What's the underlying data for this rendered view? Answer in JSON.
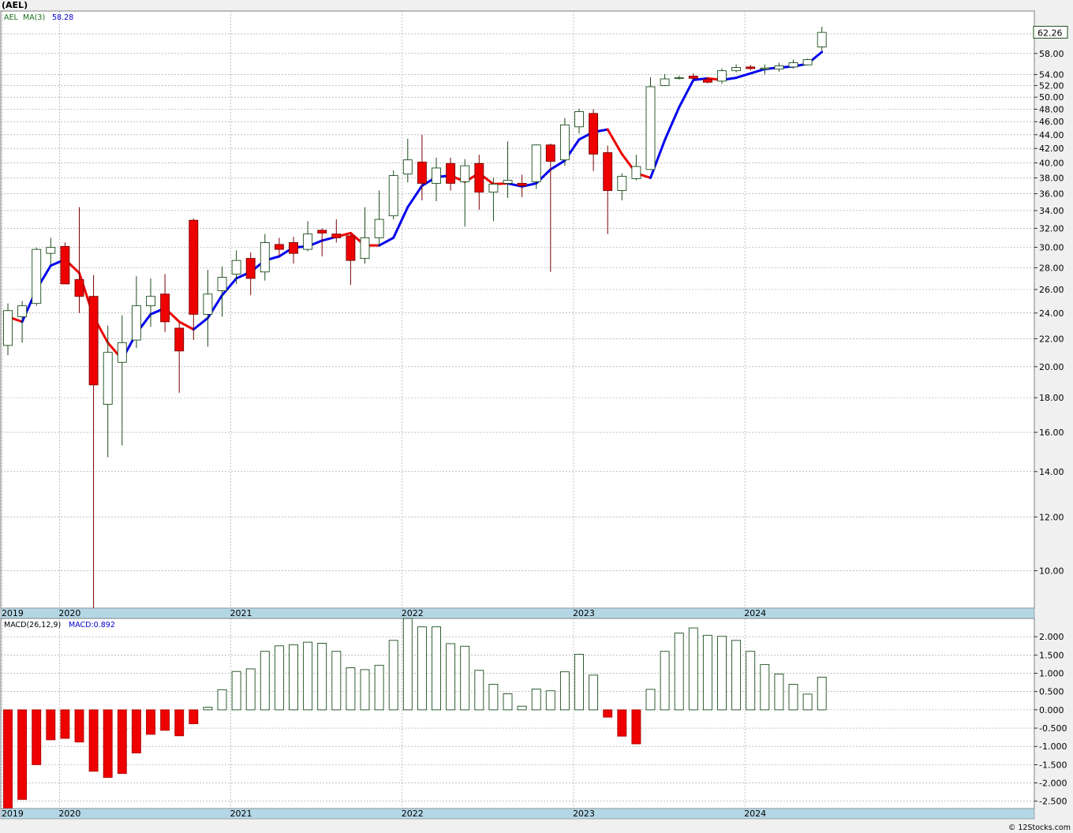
{
  "header": {
    "title": "(AEL)"
  },
  "legend": {
    "ticker": "AEL",
    "ma_label": "MA(3)",
    "ma_value": "58.28",
    "ma_color": "#00008b",
    "ma_up_color": "#0000ee",
    "ma_down_color": "#ee0000"
  },
  "macd_legend": {
    "label": "MACD(26,12,9)",
    "value_label": "MACD:0.892"
  },
  "last_price": "62.26",
  "footer": {
    "credit": "© 12Stocks.com"
  },
  "colors": {
    "up_outline": "#1a4d1a",
    "down_fill": "#ee0000",
    "axis_band": "#b4d7e6"
  },
  "chart_data": [
    {
      "type": "candlestick",
      "title": "(AEL)",
      "scale": "log",
      "ylim": [
        8.8,
        67
      ],
      "y_ticks": [
        10,
        12,
        14,
        16,
        18,
        20,
        22,
        24,
        26,
        28,
        30,
        32,
        34,
        36,
        38,
        40,
        42,
        44,
        46,
        48,
        50,
        52,
        54,
        58,
        62
      ],
      "x_ticks": [
        {
          "label": "2019",
          "index": 0
        },
        {
          "label": "2020",
          "index": 4
        },
        {
          "label": "2021",
          "index": 16
        },
        {
          "label": "2022",
          "index": 28
        },
        {
          "label": "2023",
          "index": 40
        },
        {
          "label": "2024",
          "index": 52
        }
      ],
      "candles": [
        {
          "o": 21.5,
          "h": 24.8,
          "l": 20.8,
          "c": 24.2
        },
        {
          "o": 23.7,
          "h": 25.0,
          "l": 21.7,
          "c": 24.6
        },
        {
          "o": 24.8,
          "h": 30.0,
          "l": 24.6,
          "c": 29.8
        },
        {
          "o": 29.4,
          "h": 31.0,
          "l": 28.3,
          "c": 30.0
        },
        {
          "o": 30.1,
          "h": 30.5,
          "l": 26.5,
          "c": 26.5
        },
        {
          "o": 26.9,
          "h": 34.4,
          "l": 24.0,
          "c": 25.4
        },
        {
          "o": 25.4,
          "h": 27.3,
          "l": 8.5,
          "c": 18.8
        },
        {
          "o": 17.6,
          "h": 23.0,
          "l": 14.7,
          "c": 21.0
        },
        {
          "o": 20.3,
          "h": 23.8,
          "l": 15.3,
          "c": 21.7
        },
        {
          "o": 21.9,
          "h": 27.2,
          "l": 21.3,
          "c": 24.6
        },
        {
          "o": 24.6,
          "h": 27.0,
          "l": 22.9,
          "c": 25.4
        },
        {
          "o": 25.6,
          "h": 27.4,
          "l": 22.5,
          "c": 23.3
        },
        {
          "o": 22.8,
          "h": 23.2,
          "l": 18.3,
          "c": 21.1
        },
        {
          "o": 32.9,
          "h": 33.1,
          "l": 21.9,
          "c": 23.9
        },
        {
          "o": 23.9,
          "h": 27.8,
          "l": 21.4,
          "c": 25.6
        },
        {
          "o": 25.9,
          "h": 28.1,
          "l": 23.7,
          "c": 27.1
        },
        {
          "o": 27.4,
          "h": 29.7,
          "l": 26.5,
          "c": 28.7
        },
        {
          "o": 28.9,
          "h": 29.5,
          "l": 25.5,
          "c": 27.0
        },
        {
          "o": 27.6,
          "h": 31.4,
          "l": 26.8,
          "c": 30.5
        },
        {
          "o": 30.3,
          "h": 31.0,
          "l": 29.1,
          "c": 29.8
        },
        {
          "o": 30.5,
          "h": 31.1,
          "l": 28.4,
          "c": 29.4
        },
        {
          "o": 29.8,
          "h": 32.8,
          "l": 29.6,
          "c": 31.4
        },
        {
          "o": 31.8,
          "h": 32.0,
          "l": 29.1,
          "c": 31.5
        },
        {
          "o": 31.4,
          "h": 33.0,
          "l": 30.5,
          "c": 31.0
        },
        {
          "o": 31.2,
          "h": 31.4,
          "l": 26.4,
          "c": 28.7
        },
        {
          "o": 28.9,
          "h": 34.4,
          "l": 28.4,
          "c": 31.0
        },
        {
          "o": 31.0,
          "h": 36.4,
          "l": 30.1,
          "c": 33.0
        },
        {
          "o": 33.4,
          "h": 39.0,
          "l": 33.0,
          "c": 38.3
        },
        {
          "o": 38.5,
          "h": 43.4,
          "l": 37.4,
          "c": 40.4
        },
        {
          "o": 40.1,
          "h": 44.0,
          "l": 35.2,
          "c": 37.3
        },
        {
          "o": 37.3,
          "h": 40.7,
          "l": 35.1,
          "c": 39.3
        },
        {
          "o": 39.9,
          "h": 40.7,
          "l": 36.4,
          "c": 37.3
        },
        {
          "o": 37.5,
          "h": 40.5,
          "l": 32.2,
          "c": 39.6
        },
        {
          "o": 39.9,
          "h": 41.1,
          "l": 34.1,
          "c": 36.2
        },
        {
          "o": 36.2,
          "h": 38.0,
          "l": 32.8,
          "c": 37.2
        },
        {
          "o": 37.3,
          "h": 43.0,
          "l": 35.5,
          "c": 37.7
        },
        {
          "o": 37.3,
          "h": 38.4,
          "l": 35.6,
          "c": 37.0
        },
        {
          "o": 37.5,
          "h": 42.6,
          "l": 36.6,
          "c": 42.5
        },
        {
          "o": 42.5,
          "h": 42.7,
          "l": 27.6,
          "c": 40.2
        },
        {
          "o": 40.4,
          "h": 46.6,
          "l": 39.6,
          "c": 45.5
        },
        {
          "o": 45.2,
          "h": 48.1,
          "l": 44.2,
          "c": 47.6
        },
        {
          "o": 47.3,
          "h": 48.0,
          "l": 38.9,
          "c": 41.2
        },
        {
          "o": 41.4,
          "h": 42.4,
          "l": 31.4,
          "c": 36.4
        },
        {
          "o": 36.4,
          "h": 38.6,
          "l": 35.2,
          "c": 38.2
        },
        {
          "o": 37.9,
          "h": 41.1,
          "l": 37.7,
          "c": 39.5
        },
        {
          "o": 39.1,
          "h": 53.5,
          "l": 39.0,
          "c": 51.8
        },
        {
          "o": 52.0,
          "h": 54.1,
          "l": 51.9,
          "c": 53.2
        },
        {
          "o": 53.3,
          "h": 53.8,
          "l": 53.1,
          "c": 53.4
        },
        {
          "o": 53.7,
          "h": 54.2,
          "l": 53.1,
          "c": 53.3
        },
        {
          "o": 53.1,
          "h": 53.4,
          "l": 52.4,
          "c": 52.6
        },
        {
          "o": 52.8,
          "h": 55.1,
          "l": 52.3,
          "c": 54.7
        },
        {
          "o": 54.7,
          "h": 55.9,
          "l": 54.4,
          "c": 55.3
        },
        {
          "o": 55.4,
          "h": 55.8,
          "l": 54.8,
          "c": 55.1
        },
        {
          "o": 55.0,
          "h": 55.9,
          "l": 54.0,
          "c": 55.2
        },
        {
          "o": 55.0,
          "h": 56.2,
          "l": 54.5,
          "c": 55.6
        },
        {
          "o": 55.4,
          "h": 56.8,
          "l": 55.1,
          "c": 56.2
        },
        {
          "o": 55.8,
          "h": 57.0,
          "l": 55.7,
          "c": 56.8
        },
        {
          "o": 59.3,
          "h": 63.5,
          "l": 58.6,
          "c": 62.3
        }
      ],
      "ma3": [
        23.7,
        23.3,
        26.0,
        28.2,
        28.8,
        27.5,
        23.7,
        21.7,
        20.5,
        22.4,
        23.9,
        24.4,
        23.3,
        22.7,
        23.6,
        25.5,
        27.0,
        27.6,
        28.7,
        29.1,
        30.0,
        30.1,
        30.7,
        31.1,
        31.5,
        30.2,
        30.2,
        31.0,
        34.4,
        37.0,
        38.1,
        38.3,
        37.5,
        38.6,
        37.2,
        37.3,
        36.9,
        37.3,
        39.1,
        40.3,
        43.3,
        44.4,
        44.8,
        41.2,
        38.6,
        38.0,
        43.2,
        48.3,
        53.0,
        53.3,
        53.0,
        53.4,
        54.2,
        55.0,
        55.3,
        55.5,
        56.0,
        58.3
      ],
      "ma3_trend": [
        "down",
        "down",
        "up",
        "up",
        "up",
        "down",
        "down",
        "down",
        "down",
        "up",
        "up",
        "up",
        "down",
        "down",
        "up",
        "up",
        "up",
        "up",
        "up",
        "up",
        "up",
        "up",
        "up",
        "up",
        "down",
        "down",
        "down",
        "up",
        "up",
        "up",
        "up",
        "up",
        "down",
        "down",
        "down",
        "down",
        "up",
        "up",
        "up",
        "up",
        "up",
        "up",
        "up",
        "down",
        "down",
        "down",
        "up",
        "up",
        "up",
        "up",
        "down",
        "up",
        "up",
        "up",
        "up",
        "up",
        "up",
        "up"
      ]
    },
    {
      "type": "bar",
      "title": "MACD(26,12,9)",
      "ylim": [
        -2.7,
        2.5
      ],
      "y_ticks": [
        -2.5,
        -2.0,
        -1.5,
        -1.0,
        -0.5,
        0.0,
        0.5,
        1.0,
        1.5,
        2.0
      ],
      "values": [
        -3.0,
        -2.45,
        -1.5,
        -0.82,
        -0.78,
        -0.88,
        -1.68,
        -1.85,
        -1.74,
        -1.18,
        -0.67,
        -0.56,
        -0.71,
        -0.38,
        0.07,
        0.55,
        1.05,
        1.12,
        1.6,
        1.75,
        1.78,
        1.85,
        1.82,
        1.6,
        1.15,
        1.1,
        1.22,
        1.9,
        2.5,
        2.27,
        2.27,
        1.81,
        1.74,
        1.08,
        0.7,
        0.44,
        0.1,
        0.57,
        0.52,
        1.04,
        1.52,
        0.95,
        -0.2,
        -0.72,
        -0.93,
        0.56,
        1.6,
        2.1,
        2.24,
        2.04,
        2.01,
        1.9,
        1.6,
        1.24,
        0.98,
        0.7,
        0.43,
        0.892
      ]
    }
  ]
}
